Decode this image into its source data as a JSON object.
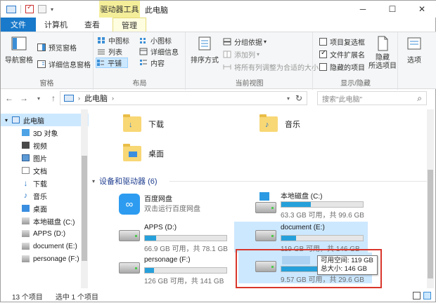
{
  "window": {
    "context_tab_title": "驱动器工具",
    "title": "此电脑"
  },
  "tabs": [
    "文件",
    "计算机",
    "查看",
    "管理"
  ],
  "ribbon": {
    "pane_group": {
      "nav_pane": "导航窗格",
      "preview_pane": "预览窗格",
      "details_pane": "详细信息窗格",
      "label": "窗格"
    },
    "layout_group": {
      "items": [
        "中图标",
        "小图标",
        "列表",
        "详细信息",
        "平铺",
        "内容"
      ],
      "label": "布局"
    },
    "view_group": {
      "sort_by": "排序方式",
      "group_by": "分组依据",
      "add_column": "添加列",
      "fit_columns": "将所有列调整为合适的大小",
      "label": "当前视图"
    },
    "show_group": {
      "item_checkboxes": "项目复选框",
      "file_extensions": "文件扩展名",
      "hidden_items": "隐藏的项目",
      "hide_selected": "隐藏\n所选项目",
      "label": "显示/隐藏"
    },
    "options": "选项"
  },
  "address": {
    "path": "此电脑",
    "search_placeholder": "搜索\"此电脑\""
  },
  "nav_items": [
    "此电脑",
    "3D 对象",
    "视频",
    "图片",
    "文档",
    "下载",
    "音乐",
    "桌面",
    "本地磁盘 (C:)",
    "APPS (D:)",
    "document (E:)",
    "personage (F:)"
  ],
  "folders": [
    "下载",
    "音乐",
    "桌面"
  ],
  "section_title": "设备和驱动器 (6)",
  "drives": [
    {
      "name": "百度网盘",
      "info": "双击运行百度网盘"
    },
    {
      "name": "本地磁盘 (C:)",
      "info": "63.3 GB 可用，共 99.6 GB",
      "used": 0.36
    },
    {
      "name": "APPS (D:)",
      "info": "66.9 GB 可用，共 78.1 GB",
      "used": 0.14
    },
    {
      "name": "document (E:)",
      "info": "119 GB 可用，共 146 GB",
      "used": 0.18
    },
    {
      "name": "personage (F:)",
      "info": "126 GB 可用，共 141 GB",
      "used": 0.11
    },
    {
      "name": "",
      "info": "9.57 GB 可用，共 29.6 GB",
      "used": 0.68
    }
  ],
  "tooltip": {
    "line1": "可用空间: 119 GB",
    "line2": "总大小: 146 GB"
  },
  "status": {
    "count": "13 个项目",
    "selected": "选中 1 个项目"
  },
  "colors": {
    "accent": "#1979ca",
    "selection": "#cce8ff",
    "drive_bar": "#26a0da",
    "highlight_box": "#d9362c"
  }
}
